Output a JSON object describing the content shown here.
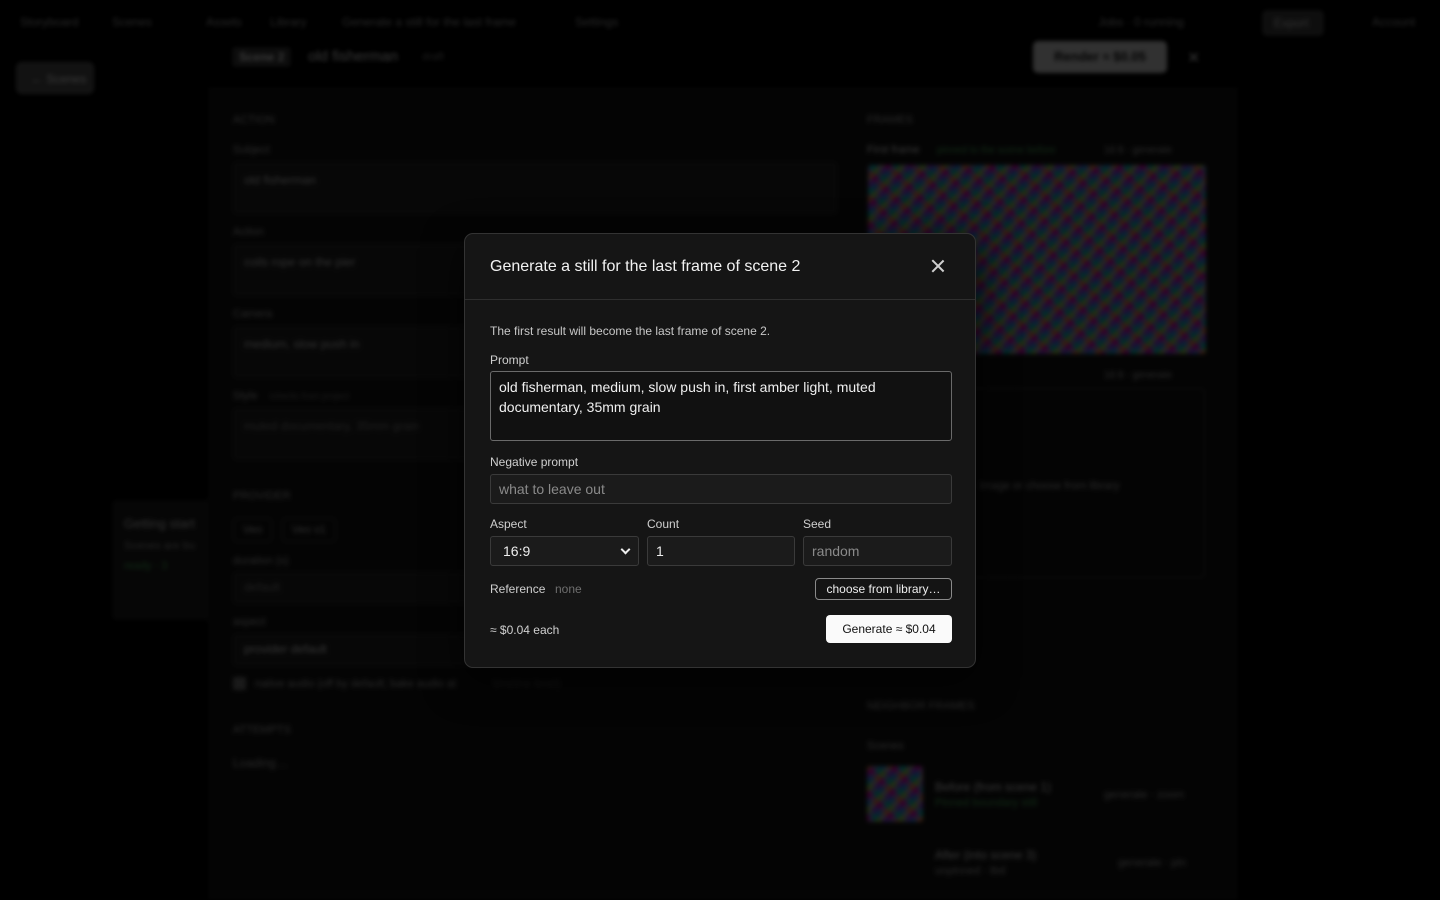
{
  "background": {
    "topbar": {
      "items": [
        "Storyboard",
        "Scenes",
        "Assets",
        "Library",
        "Generate a still for the last frame",
        "Settings",
        "Account"
      ],
      "right_label": "Jobs · 0 running",
      "right_button": "Export"
    },
    "sidebar": {
      "back_button": "← Scenes"
    },
    "scene": {
      "chip": "Scene 2",
      "title": "old fisherman",
      "subtitle": "draft",
      "render_button": "Render ≈ $0.05",
      "close_symbol": "✕"
    },
    "fields": {
      "section_label": "ACTION",
      "subject_label": "Subject",
      "subject_value": "old fisherman",
      "action_label": "Action",
      "action_value": "coils rope on the pier",
      "camera_label": "Camera",
      "camera_value": "medium, slow push in",
      "style_label": "Style",
      "style_note": "inherits from project",
      "style_value": "muted documentary, 35mm grain",
      "provider_label": "PROVIDER",
      "tag_1": "Veo",
      "tag_2": "Veo v1",
      "duration_label": "duration (s)",
      "duration_value": "default",
      "aspect_label": "aspect",
      "aspect_value": "provider default",
      "audio_checkbox_label": "native audio (off by default; bake audio at",
      "audio_checkbox_link": "timeline level)",
      "attempts_label": "ATTEMPTS",
      "loading_text": "Loading…"
    },
    "right_panel": {
      "frames_label": "FRAMES",
      "first_frame_label": "First frame",
      "first_frame_note": "pinned to the scene before",
      "first_frame_actions": "16:9 · generate",
      "last_frame_actions": "16:9 · generate",
      "dropzone_text": "image or choose from library",
      "neighbors_label": "NEIGHBOR FRAMES",
      "scenes_label": "Scenes",
      "row_1_title": "Before (from scene 1)",
      "row_1_status": "Pinned boundary still",
      "row_1_actions": "generate · zoom",
      "row_2_title": "After (into scene 3)",
      "row_2_status": "unpinned · tbd",
      "row_2_actions": "generate · pin"
    },
    "left_card": {
      "title": "Getting start",
      "lines": [
        "Scenes are bu",
        "ready · 3"
      ]
    }
  },
  "dialog": {
    "title": "Generate a still for the last frame of scene 2",
    "note": "The first result will become the last frame of scene 2.",
    "prompt_label": "Prompt",
    "prompt_value": "old fisherman, medium, slow push in, first amber light, muted documentary, 35mm grain",
    "negative_label": "Negative prompt",
    "negative_placeholder": "what to leave out",
    "aspect_label": "Aspect",
    "aspect_value": "16:9",
    "count_label": "Count",
    "count_value": "1",
    "seed_label": "Seed",
    "seed_placeholder": "random",
    "reference_label": "Reference",
    "reference_value": "none",
    "library_button": "choose from library…",
    "cost_each": "≈ $0.04 each",
    "generate_button": "Generate ≈ $0.04"
  }
}
